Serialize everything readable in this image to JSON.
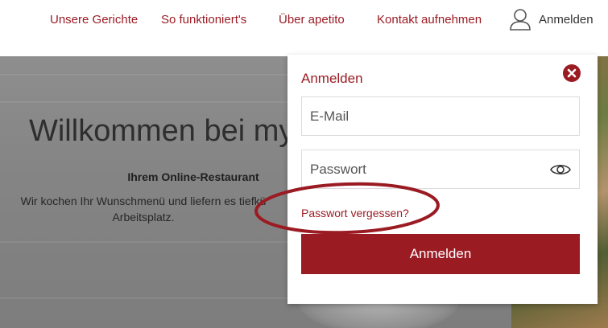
{
  "nav": {
    "items": [
      {
        "label": "Unsere Gerichte"
      },
      {
        "label": "So funktioniert's"
      },
      {
        "label": "Über apetito"
      },
      {
        "label": "Kontakt aufnehmen"
      }
    ],
    "login_label": "Anmelden",
    "user_icon": "user-icon"
  },
  "hero": {
    "title": "Willkommen bei myl",
    "subtitle": "Ihrem Online-Restaurant",
    "text": "Wir kochen Ihr Wunschmenü und liefern es tiefkü Arbeitsplatz."
  },
  "login_panel": {
    "title": "Anmelden",
    "email_placeholder": "E-Mail",
    "password_placeholder": "Passwort",
    "forgot_link": "Passwort vergessen?",
    "submit_label": "Anmelden",
    "close_icon": "close-icon",
    "eye_icon": "eye-icon"
  },
  "colors": {
    "brand": "#9b1b23",
    "annotation": "#9b1b23"
  }
}
